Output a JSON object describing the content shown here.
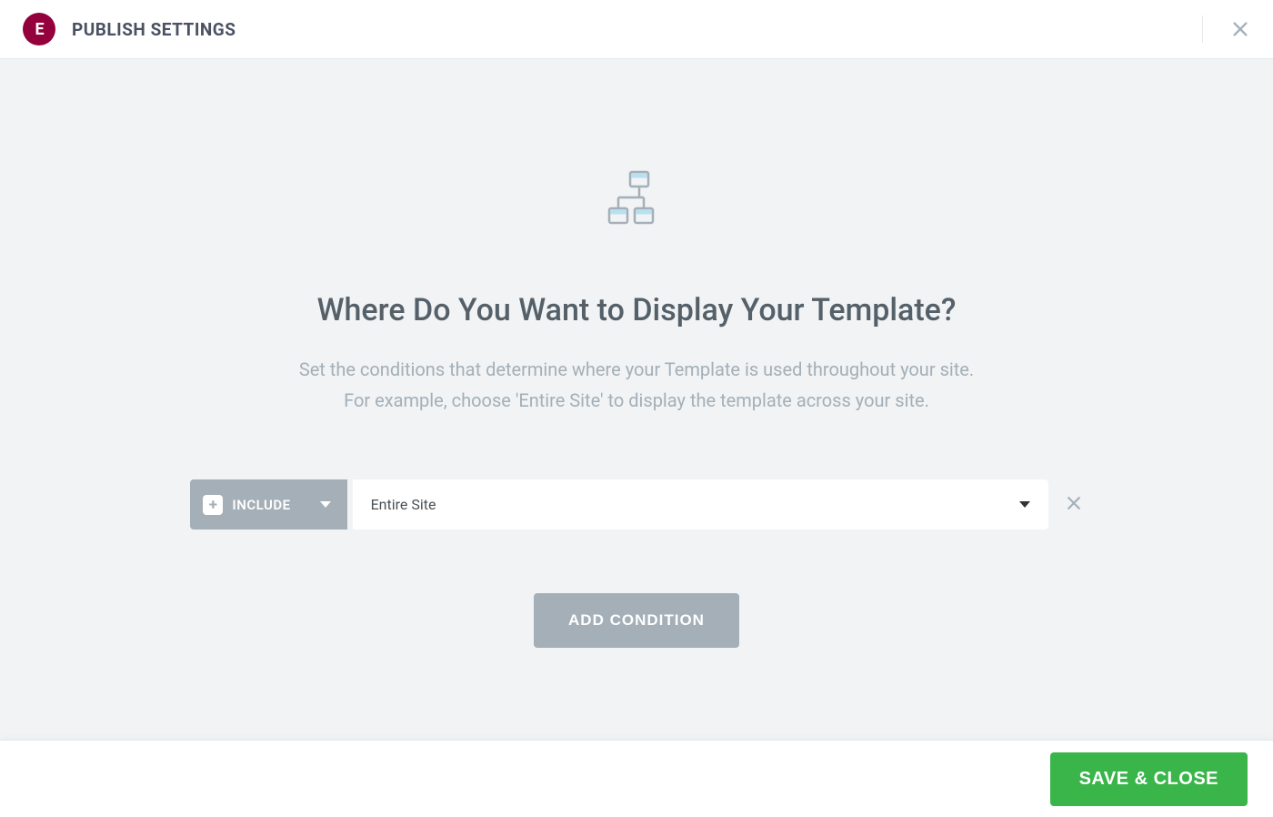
{
  "header": {
    "title": "PUBLISH SETTINGS"
  },
  "main": {
    "heading": "Where Do You Want to Display Your Template?",
    "description_line1": "Set the conditions that determine where your Template is used throughout your site.",
    "description_line2": "For example, choose 'Entire Site' to display the template across your site."
  },
  "condition": {
    "mode_label": "INCLUDE",
    "location_value": "Entire Site"
  },
  "buttons": {
    "add_condition": "ADD CONDITION",
    "save_close": "SAVE & CLOSE"
  }
}
